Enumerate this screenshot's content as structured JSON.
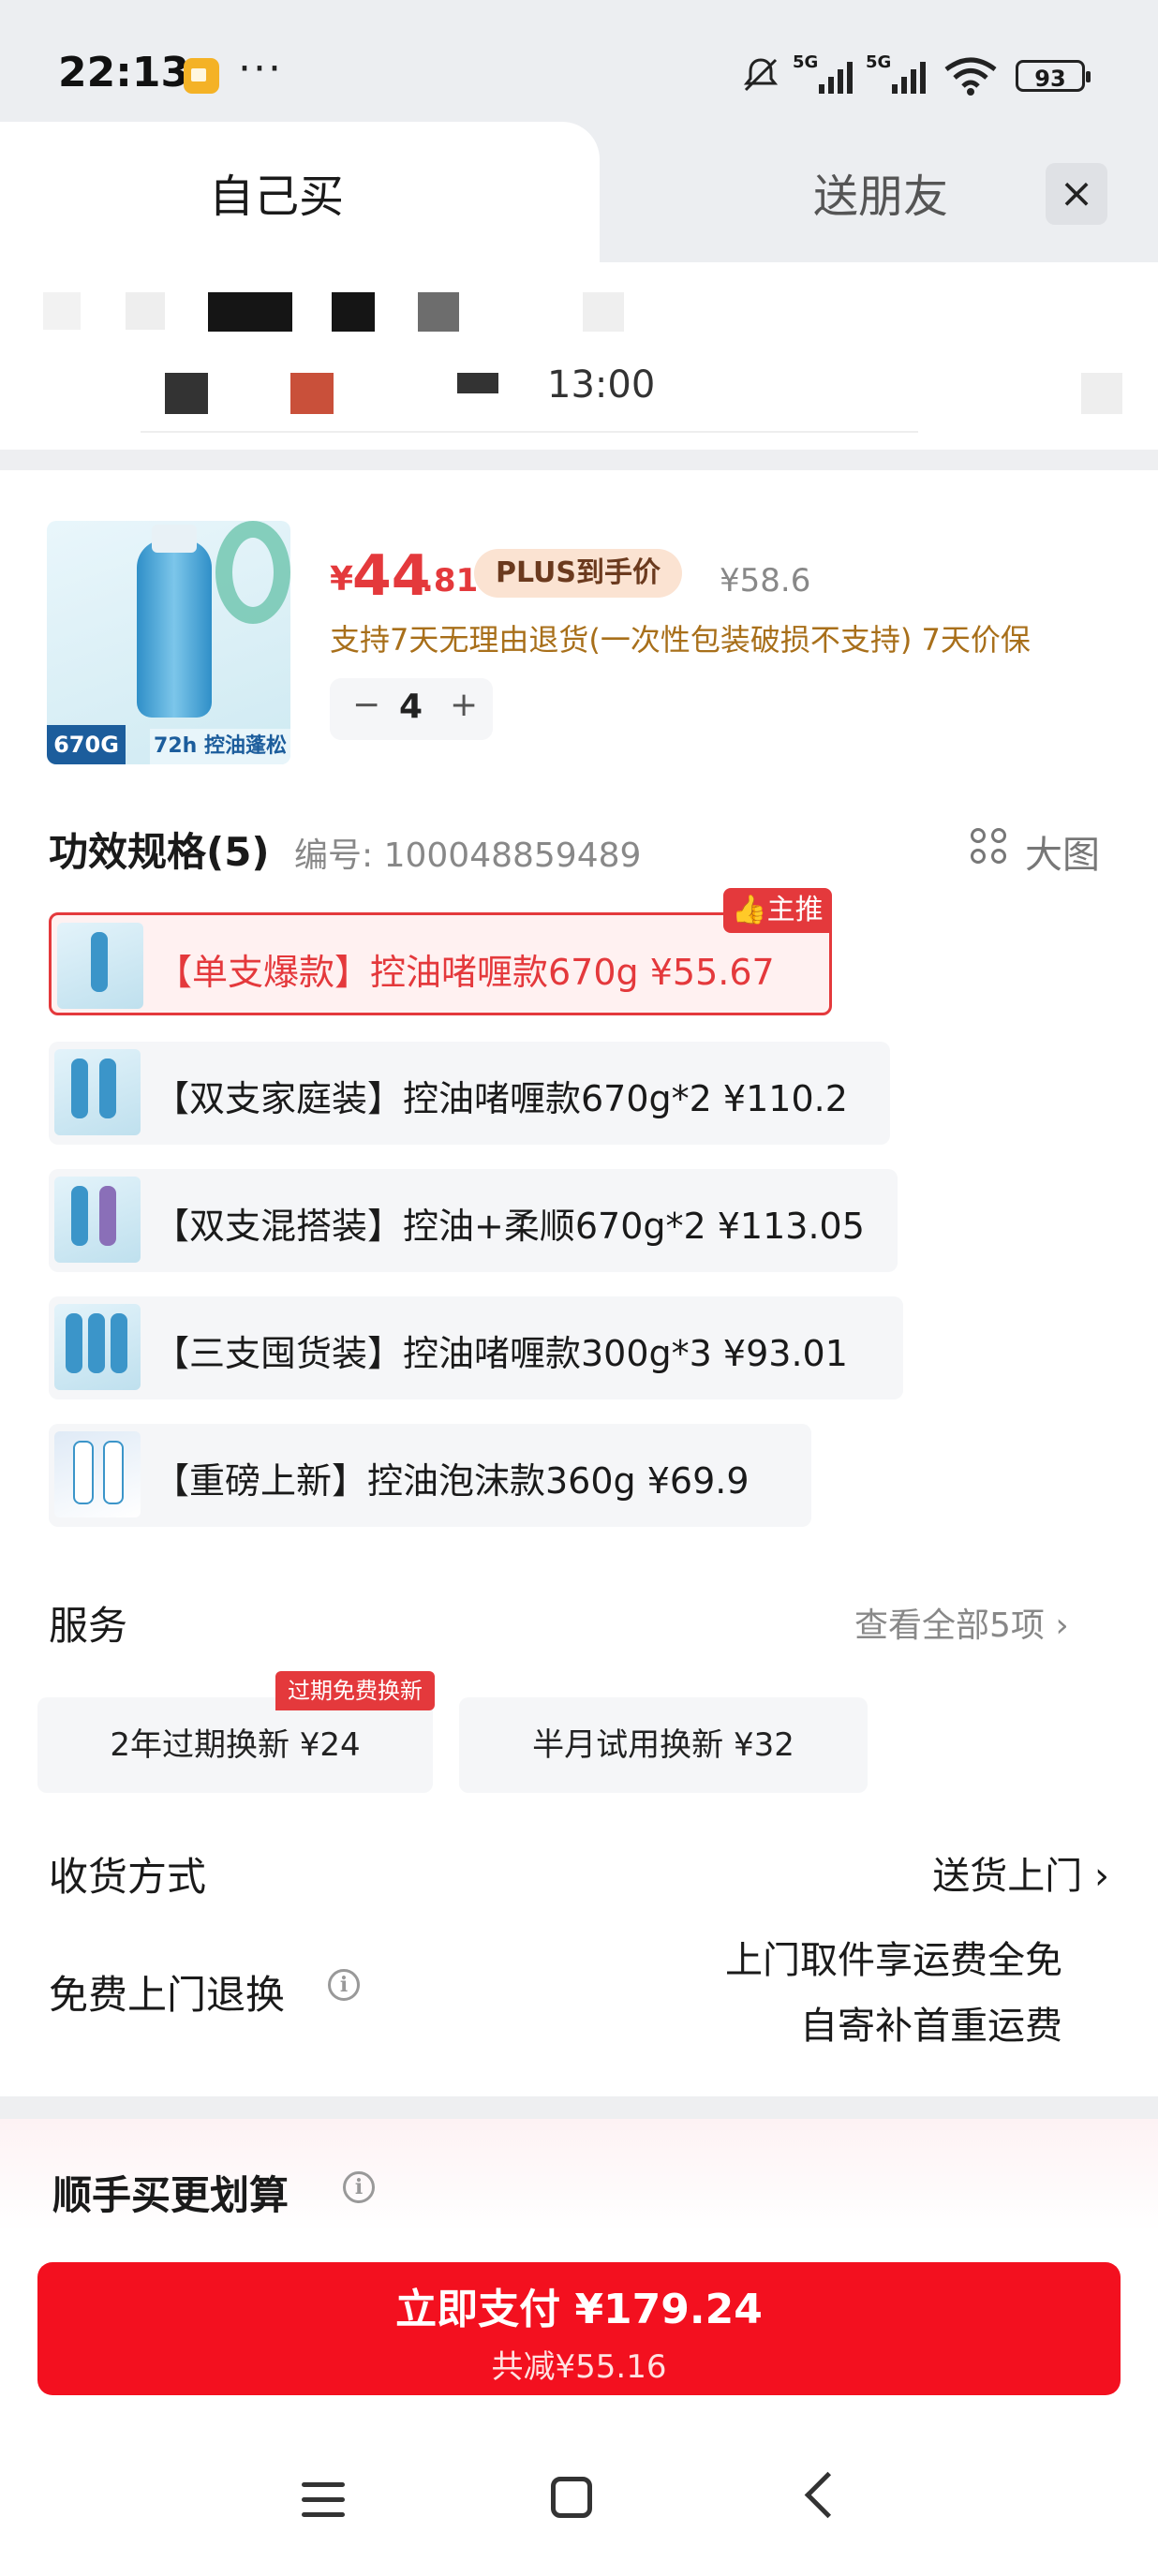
{
  "status_bar": {
    "time": "22:13",
    "more": "···",
    "battery": "93",
    "network": "5G"
  },
  "tabs": {
    "self": "自己买",
    "friend": "送朋友",
    "close": "×"
  },
  "address": {
    "partial_text": "13:00"
  },
  "product": {
    "currency": "¥",
    "price_int": "44",
    "price_dec": ".81",
    "plus_label": "PLUS到手价",
    "original_price": "¥58.6",
    "return_policy": "支持7天无理由退货(一次性包装破损不支持)  7天价保",
    "quantity": "4",
    "minus": "−",
    "plus": "+",
    "image_tags": {
      "size": "670G",
      "feature": "72h 控油蓬松"
    }
  },
  "spec": {
    "title": "功效规格(5)",
    "code": "编号: 100048859489",
    "big_image": "大图",
    "recommend_badge": "👍主推",
    "items": [
      {
        "label": "【单支爆款】控油啫喱款670g   ¥55.67",
        "selected": true
      },
      {
        "label": "【双支家庭装】控油啫喱款670g*2   ¥110.2",
        "selected": false
      },
      {
        "label": "【双支混搭装】控油+柔顺670g*2   ¥113.05",
        "selected": false
      },
      {
        "label": "【三支囤货装】控油啫喱款300g*3   ¥93.01",
        "selected": false
      },
      {
        "label": "【重磅上新】控油泡沫款360g   ¥69.9",
        "selected": false
      }
    ]
  },
  "services": {
    "title": "服务",
    "view_all": "查看全部5项  ›",
    "badge": "过期免费换新",
    "chips": [
      "2年过期换新  ¥24",
      "半月试用换新  ¥32"
    ]
  },
  "delivery": {
    "label": "收货方式",
    "value": "送货上门  ›"
  },
  "free_return": {
    "label": "免费上门退换",
    "line1": "上门取件享运费全免",
    "line2": "自寄补首重运费",
    "info": "i"
  },
  "more_deal": {
    "title": "顺手买更划算",
    "info": "i"
  },
  "pay": {
    "main": "立即支付 ¥179.24",
    "sub": "共减¥55.16"
  }
}
